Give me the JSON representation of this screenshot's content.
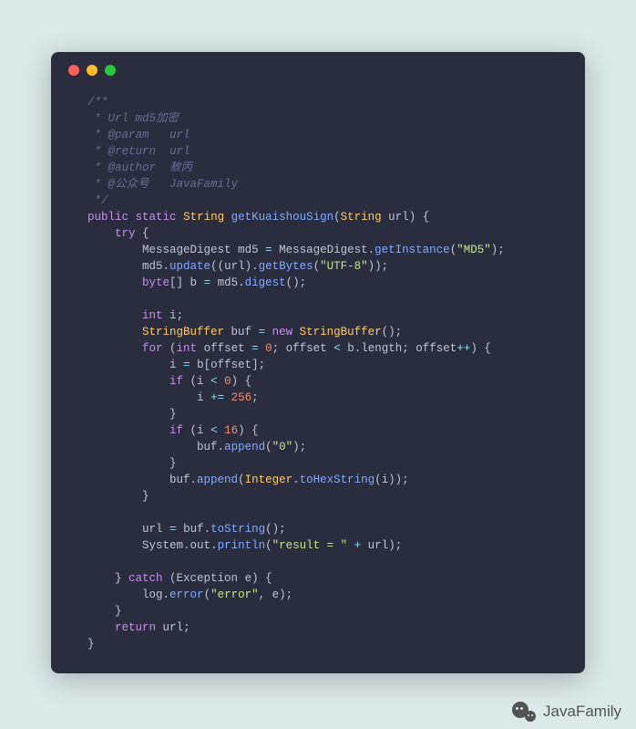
{
  "code": {
    "comment1": "/**",
    "comment2": " * Url md5加密",
    "comment3": " * @param   url",
    "comment4": " * @return  url",
    "comment5": " * @author  敖丙",
    "comment6": " * @公众号   JavaFamily",
    "comment7": " */",
    "kw_public": "public",
    "kw_static": "static",
    "type_String": "String",
    "fn_name": "getKuaishouSign",
    "param_url": "url",
    "kw_try": "try",
    "type_MessageDigest": "MessageDigest",
    "var_md5": "md5",
    "fn_getInstance": "getInstance",
    "str_MD5": "\"MD5\"",
    "fn_update": "update",
    "fn_getBytes": "getBytes",
    "str_UTF8": "\"UTF-8\"",
    "kw_byte": "byte",
    "var_b": "b",
    "fn_digest": "digest",
    "kw_int": "int",
    "var_i": "i",
    "type_StringBuffer": "StringBuffer",
    "var_buf": "buf",
    "kw_new": "new",
    "kw_for": "for",
    "var_offset": "offset",
    "num_0": "0",
    "prop_length": "length",
    "op_pp": "++",
    "kw_if": "if",
    "op_lt": "<",
    "op_pe": "+=",
    "num_256": "256",
    "num_16": "16",
    "fn_append": "append",
    "str_0": "\"0\"",
    "type_Integer": "Integer",
    "fn_toHexString": "toHexString",
    "fn_toString": "toString",
    "obj_System": "System",
    "obj_out": "out",
    "fn_println": "println",
    "str_result": "\"result = \"",
    "op_plus": "+",
    "kw_catch": "catch",
    "type_Exception": "Exception",
    "var_e": "e",
    "obj_log": "log",
    "fn_error": "error",
    "str_error": "\"error\"",
    "kw_return": "return"
  },
  "watermark": {
    "text": "JavaFamily"
  }
}
